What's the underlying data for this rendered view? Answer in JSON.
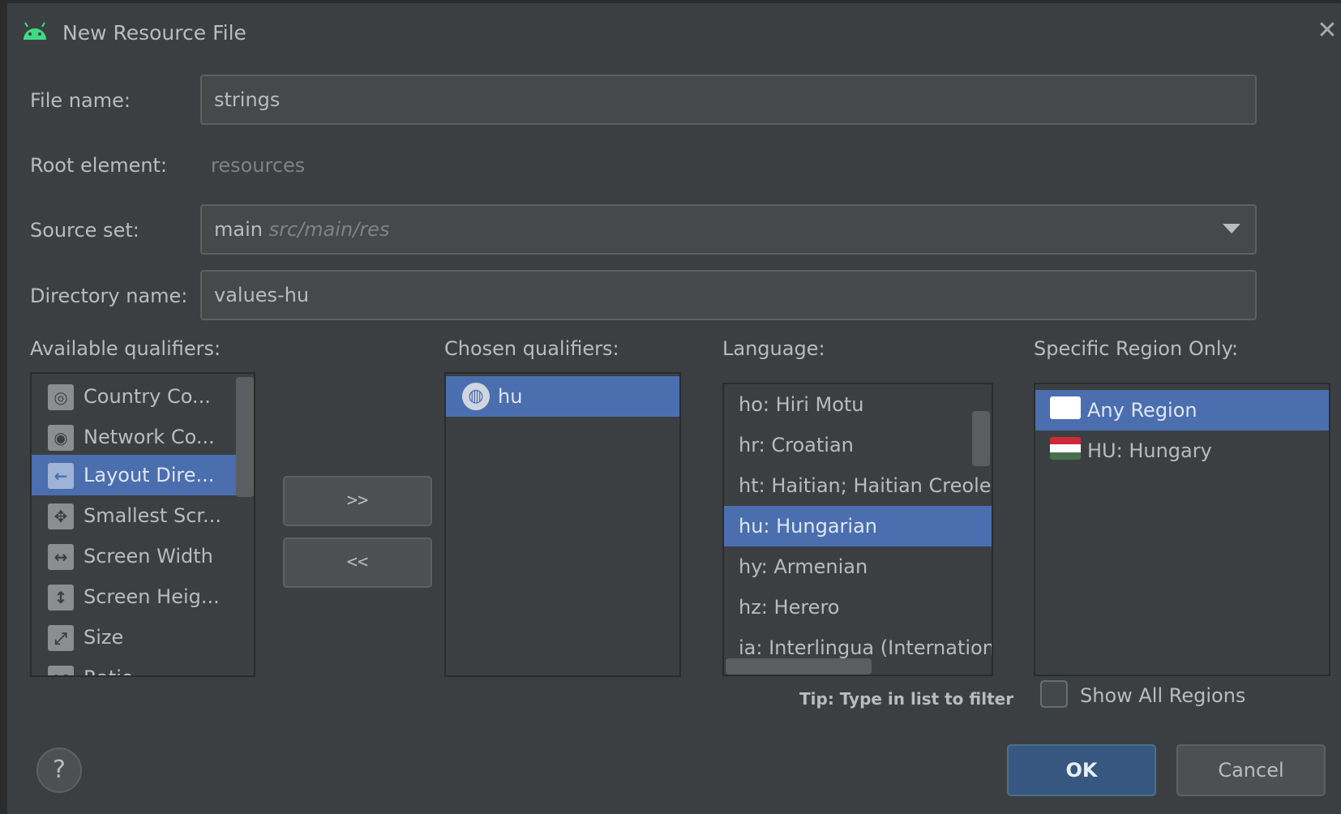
{
  "window": {
    "title": "New Resource File",
    "icon": "android-icon",
    "close_icon": "close-icon"
  },
  "form": {
    "file_name": {
      "label": "File name:",
      "value": "strings"
    },
    "root_element": {
      "label": "Root element:",
      "value": "resources"
    },
    "source_set": {
      "label": "Source set:",
      "value": "main",
      "path": "src/main/res"
    },
    "directory_name": {
      "label": "Directory name:",
      "value": "values-hu"
    }
  },
  "available_qualifiers": {
    "label": "Available qualifiers:",
    "items": [
      {
        "label": "Country Co...",
        "icon": "country-code-icon",
        "selected": false
      },
      {
        "label": "Network Co...",
        "icon": "network-code-icon",
        "selected": false
      },
      {
        "label": "Layout Dire...",
        "icon": "layout-direction-icon",
        "selected": true
      },
      {
        "label": "Smallest Scr...",
        "icon": "smallest-screen-icon",
        "selected": false
      },
      {
        "label": "Screen Width",
        "icon": "screen-width-icon",
        "selected": false
      },
      {
        "label": "Screen Heig...",
        "icon": "screen-height-icon",
        "selected": false
      },
      {
        "label": "Size",
        "icon": "size-icon",
        "selected": false
      },
      {
        "label": "Ratio",
        "icon": "ratio-icon",
        "selected": false
      }
    ]
  },
  "move_buttons": {
    "add": ">>",
    "remove": "<<"
  },
  "chosen_qualifiers": {
    "label": "Chosen qualifiers:",
    "items": [
      {
        "label": "hu",
        "icon": "globe-icon",
        "selected": true
      }
    ]
  },
  "language": {
    "label": "Language:",
    "items": [
      {
        "label": "ho: Hiri Motu",
        "selected": false
      },
      {
        "label": "hr: Croatian",
        "selected": false
      },
      {
        "label": "ht: Haitian; Haitian Creole",
        "selected": false
      },
      {
        "label": "hu: Hungarian",
        "selected": true
      },
      {
        "label": "hy: Armenian",
        "selected": false
      },
      {
        "label": "hz: Herero",
        "selected": false
      },
      {
        "label": "ia: Interlingua (Internation",
        "selected": false
      }
    ],
    "tip": "Tip: Type in list to filter"
  },
  "region": {
    "label": "Specific Region Only:",
    "items": [
      {
        "label": "Any Region",
        "icon": "blank-flag-icon",
        "selected": true
      },
      {
        "label": "HU: Hungary",
        "icon": "hungary-flag-icon",
        "selected": false
      }
    ],
    "show_all_label": "Show All Regions",
    "show_all_checked": false
  },
  "footer": {
    "help": "?",
    "ok": "OK",
    "cancel": "Cancel"
  },
  "colors": {
    "background": "#3c3f41",
    "selection": "#4b6eaf",
    "ok_button": "#365880"
  }
}
